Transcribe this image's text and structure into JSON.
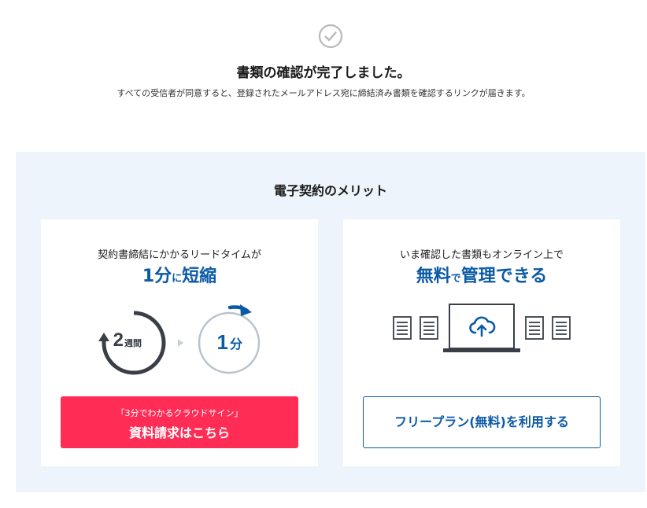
{
  "confirmation": {
    "icon": "check-circle-icon",
    "title": "書類の確認が完了しました。",
    "message": "すべての受信者が同意すると、登録されたメールアドレス宛に締結済み書類を確認するリンクが届きます。"
  },
  "merits": {
    "title": "電子契約のメリット",
    "lead_time_card": {
      "lead": "契約書締結にかかるリードタイムが",
      "headline": {
        "part1": "1分",
        "part2": "に",
        "part3": "短縮"
      },
      "before": {
        "number": "2",
        "unit": "週間"
      },
      "after": {
        "number": "1",
        "unit": "分"
      },
      "cta_sub": "「3分でわかるクラウドサイン」",
      "cta_main": "資料請求はこちら"
    },
    "free_plan_card": {
      "lead": "いま確認した書類もオンライン上で",
      "headline": {
        "part1": "無料",
        "part2": "で",
        "part3": "管理できる"
      },
      "cta": "フリープラン(無料)を利用する"
    }
  },
  "colors": {
    "brand_blue": "#0b5aa6",
    "cta_red": "#ff2d55",
    "panel_bg": "#eef4fb",
    "dark_gray": "#3a3f47",
    "light_gray": "#b9c3cc"
  }
}
